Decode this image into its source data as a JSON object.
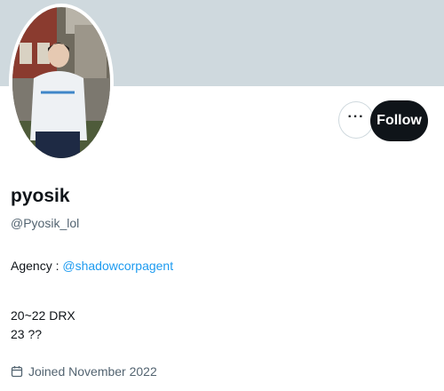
{
  "profile": {
    "display_name": "pyosik",
    "handle": "@Pyosik_lol",
    "bio": {
      "agency_prefix": "Agency : ",
      "agency_link": "@shadowcorpagent",
      "line2": "20~22 DRX",
      "line3": "23 ??"
    },
    "joined": "Joined November 2022"
  },
  "actions": {
    "more_label": "···",
    "follow_label": "Follow"
  },
  "colors": {
    "banner": "#cfd9de",
    "link": "#1d9bf0",
    "follow_bg": "#0f1419"
  },
  "icons": {
    "more": "more-horizontal-icon",
    "joined": "calendar-icon"
  }
}
